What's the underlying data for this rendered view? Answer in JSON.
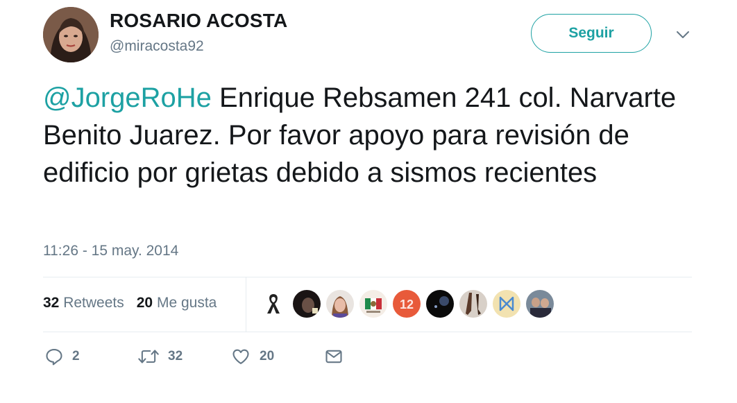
{
  "user": {
    "name": "ROSARIO ACOSTA",
    "handle": "@miracosta92"
  },
  "follow_button": {
    "label": "Seguir"
  },
  "tweet": {
    "mention": "@JorgeRoHe",
    "text": " Enrique Rebsamen 241 col. Narvarte Benito Juarez. Por favor apoyo para revisión de edificio por grietas debido a sismos recientes",
    "timestamp": "11:26 - 15 may. 2014"
  },
  "stats": {
    "retweets_count": "32",
    "retweets_label": "Retweets",
    "likes_count": "20",
    "likes_label": "Me gusta"
  },
  "actions": {
    "reply_count": "2",
    "retweet_count": "32",
    "like_count": "20"
  },
  "colors": {
    "accent": "#1da1a3",
    "secondary_text": "#657786",
    "primary_text": "#14171a",
    "divider": "#e6ecf0"
  },
  "icons": [
    "chevron-down-icon",
    "reply-icon",
    "retweet-icon",
    "heart-icon",
    "message-icon"
  ]
}
